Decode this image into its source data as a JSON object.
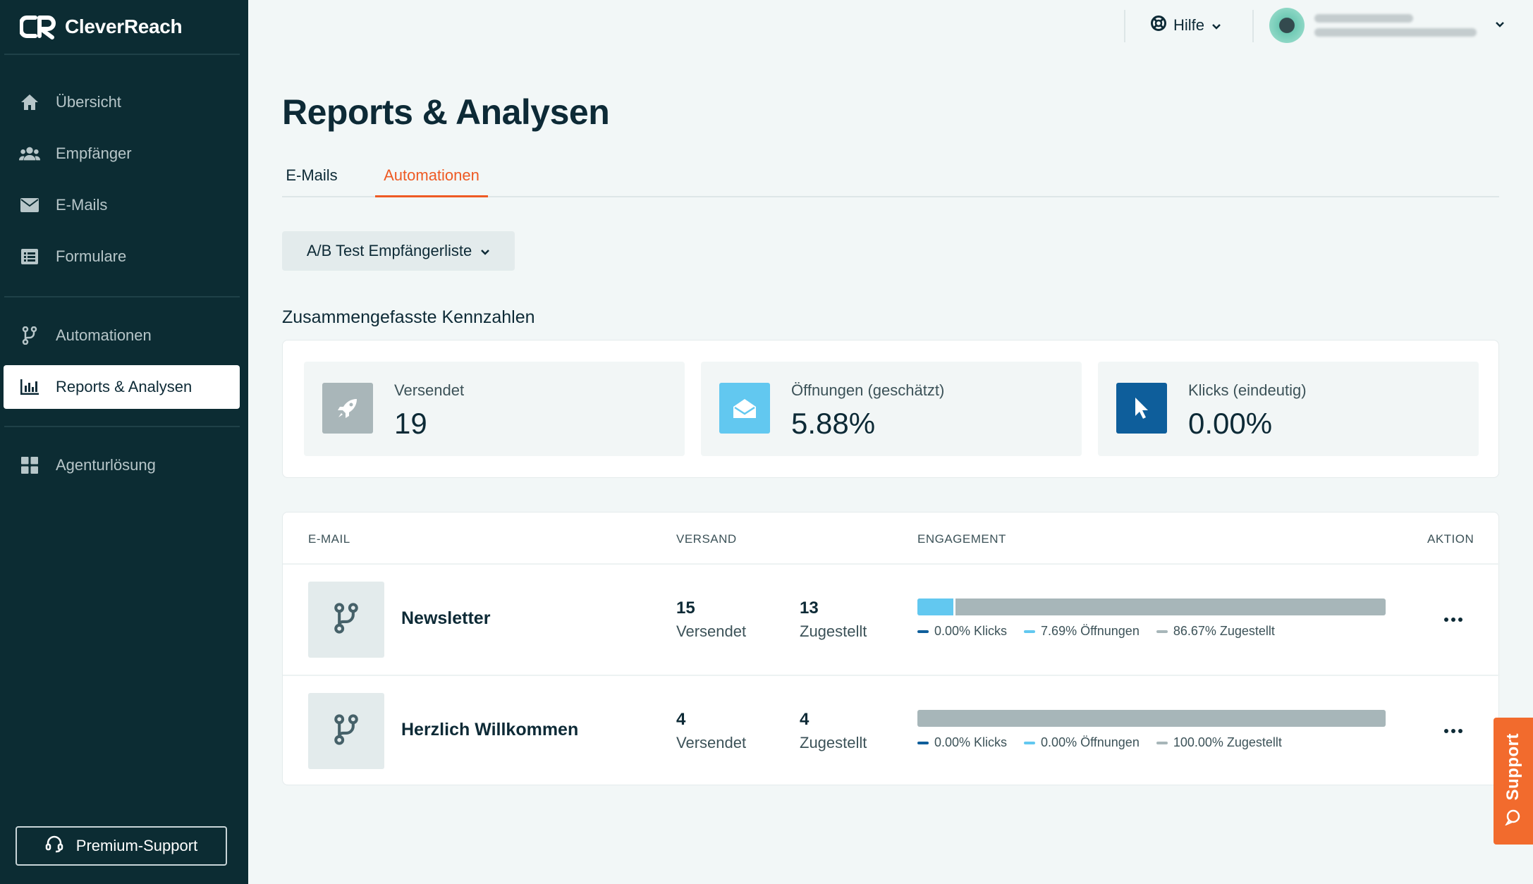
{
  "brand": {
    "name": "CleverReach"
  },
  "sidebar": {
    "items": [
      {
        "label": "Übersicht",
        "icon": "home-icon"
      },
      {
        "label": "Empfänger",
        "icon": "users-icon"
      },
      {
        "label": "E-Mails",
        "icon": "envelope-icon"
      },
      {
        "label": "Formulare",
        "icon": "form-icon"
      },
      {
        "label": "Automationen",
        "icon": "branch-icon"
      },
      {
        "label": "Reports & Analysen",
        "icon": "bar-chart-icon",
        "active": true
      },
      {
        "label": "Agenturlösung",
        "icon": "grid-icon"
      }
    ],
    "premium_label": "Premium-Support"
  },
  "topbar": {
    "help_label": "Hilfe"
  },
  "page": {
    "title": "Reports & Analysen",
    "tabs": [
      {
        "label": "E-Mails",
        "active": false
      },
      {
        "label": "Automationen",
        "active": true
      }
    ],
    "list_select": "A/B Test Empfängerliste",
    "summary_title": "Zusammengefasste Kennzahlen"
  },
  "kpis": [
    {
      "label": "Versendet",
      "value": "19",
      "icon": "rocket-icon",
      "color": "#a9b6b9"
    },
    {
      "label": "Öffnungen (geschätzt)",
      "value": "5.88%",
      "icon": "open-envelope-icon",
      "color": "#62c8f0"
    },
    {
      "label": "Klicks (eindeutig)",
      "value": "0.00%",
      "icon": "cursor-icon",
      "color": "#0e5e9b"
    }
  ],
  "table": {
    "headers": {
      "email": "E-MAIL",
      "send": "VERSAND",
      "engagement": "ENGAGEMENT",
      "action": "AKTION"
    },
    "rows": [
      {
        "name": "Newsletter",
        "sent": "15",
        "sent_label": "Versendet",
        "delivered": "13",
        "delivered_label": "Zugestellt",
        "clicks_pct": 0,
        "opens_pct": 7.69,
        "delivered_pct": 86.67,
        "legend_clicks": "0.00% Klicks",
        "legend_opens": "7.69% Öffnungen",
        "legend_delivered": "86.67% Zugestellt"
      },
      {
        "name": "Herzlich Willkommen",
        "sent": "4",
        "sent_label": "Versendet",
        "delivered": "4",
        "delivered_label": "Zugestellt",
        "clicks_pct": 0,
        "opens_pct": 0,
        "delivered_pct": 100,
        "legend_clicks": "0.00% Klicks",
        "legend_opens": "0.00% Öffnungen",
        "legend_delivered": "100.00% Zugestellt"
      }
    ]
  },
  "support": {
    "label": "Support"
  },
  "colors": {
    "sidebar_bg": "#0c2c33",
    "accent": "#ee5a24",
    "clicks": "#0e5e9b",
    "opens": "#62c8f0",
    "delivered": "#a7b6b9"
  }
}
